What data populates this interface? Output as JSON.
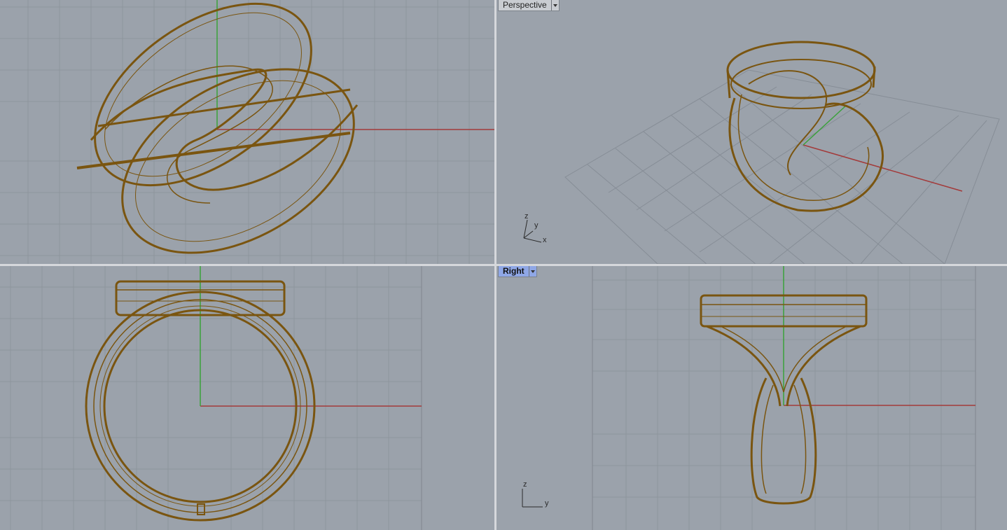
{
  "viewports": {
    "top": {
      "tab": ""
    },
    "perspective": {
      "tab": "Perspective",
      "axes": {
        "z": "z",
        "y": "y",
        "x": "x"
      }
    },
    "front": {
      "tab": ""
    },
    "right": {
      "tab": "Right",
      "axes": {
        "z": "z",
        "y": "y"
      }
    }
  },
  "colors": {
    "background": "#9ba2ab",
    "grid_minor": "#8e959d",
    "grid_major": "#80878f",
    "x_axis": "#a33a3a",
    "y_axis": "#3aa13a",
    "wireframe": "#7a5510",
    "active_tab": "#8fa7e6"
  }
}
